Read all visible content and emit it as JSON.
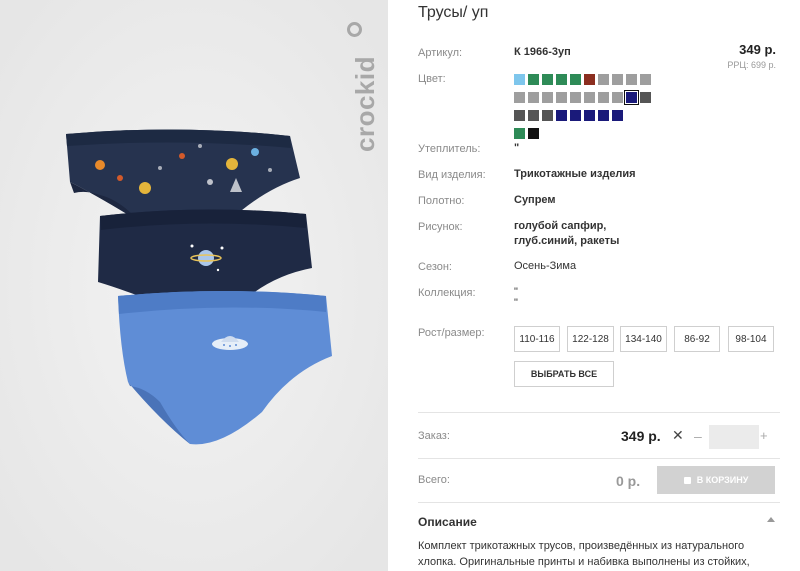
{
  "product": {
    "title": "Трусы/ уп",
    "logo_text": "crockid",
    "image_alt": "Комплект трикотажных трусов"
  },
  "attributes": {
    "article_label": "Артикул:",
    "article_value": "К 1966-3уп",
    "color_label": "Цвет:",
    "insulation_label": "Утеплитель:",
    "insulation_value": "\"",
    "type_label": "Вид изделия:",
    "type_value": "Трикотажные изделия",
    "fabric_label": "Полотно:",
    "fabric_value": "Супрем",
    "pattern_label": "Рисунок:",
    "pattern_line1": "голубой сапфир,",
    "pattern_line2": "глуб.синий, ракеты",
    "season_label": "Сезон:",
    "season_value": "Осень-Зима",
    "collection_label": "Коллекция:",
    "collection_line1": "\"",
    "collection_line2": "\"",
    "size_label": "Рост/размер:"
  },
  "price": {
    "value": "349 р.",
    "rrc": "РРЦ: 699 р."
  },
  "colors": [
    "#7ec6ec",
    "#2e8b57",
    "#2e8b57",
    "#2e8b57",
    "#2e8b57",
    "#8b2e1f",
    "#9e9e9e",
    "#9e9e9e",
    "#9e9e9e",
    "#9e9e9e",
    "#9e9e9e",
    "#9e9e9e",
    "#9e9e9e",
    "#9e9e9e",
    "#9e9e9e",
    "#9e9e9e",
    "#9e9e9e",
    "#9e9e9e",
    "#1a1a7a",
    "#555555",
    "#555555",
    "#555555",
    "#555555",
    "#1a1a7a",
    "#1a1a7a",
    "#1a1a7a",
    "#1a1a7a",
    "#1a1a7a",
    "#2e8b57",
    "#111111"
  ],
  "sizes": [
    "110-116",
    "122-128",
    "134-140",
    "86-92",
    "98-104"
  ],
  "select_all": "ВЫБРАТЬ ВСЕ",
  "order": {
    "label": "Заказ:",
    "price": "349 р.",
    "times": "✕",
    "minus": "–",
    "plus": "+",
    "qty": ""
  },
  "total": {
    "label": "Всего:",
    "value": "0 р.",
    "cart_button": "В КОРЗИНУ"
  },
  "description": {
    "title": "Описание",
    "text": "Комплект трикотажных трусов, произведённых из натурального хлопка. Оригинальные принты и набивка выполнены из стойких,"
  }
}
